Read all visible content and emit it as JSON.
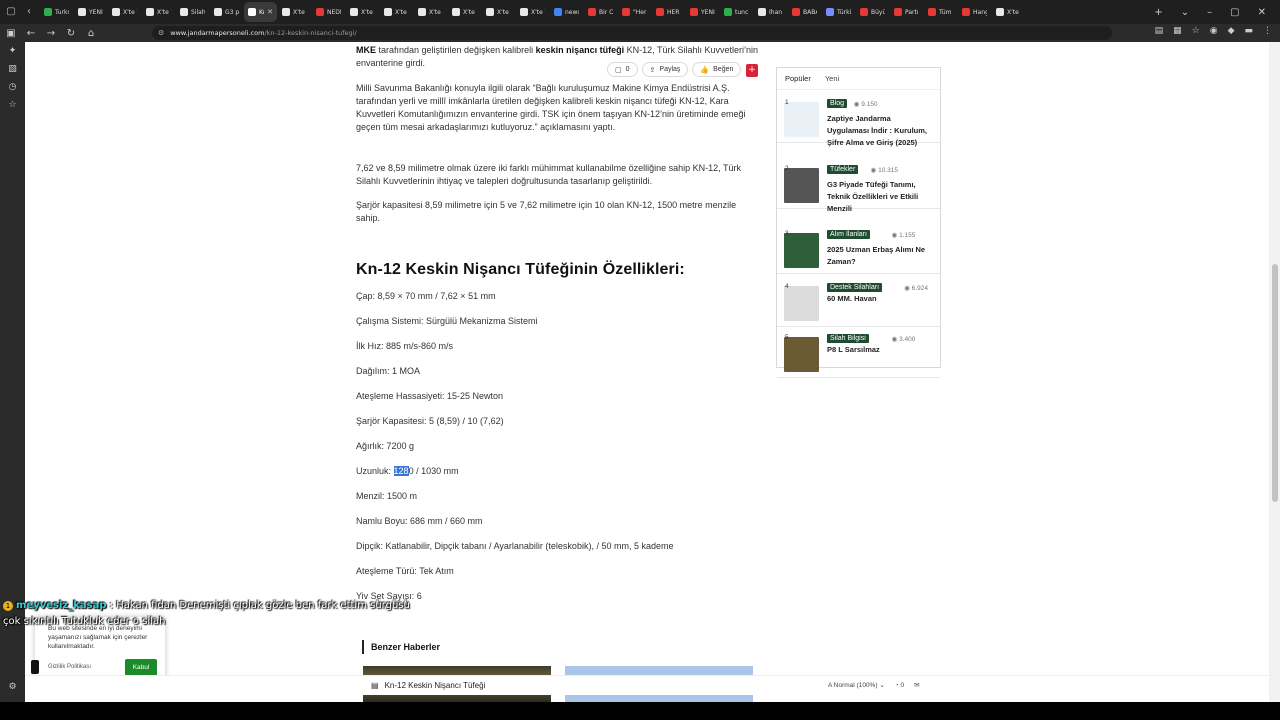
{
  "browser": {
    "tabs": [
      {
        "title": "Turkso",
        "color": "#2eae4f"
      },
      {
        "title": "YENİ I",
        "color": "#e8e8e8"
      },
      {
        "title": "X'te Tı",
        "color": "#e8e8e8"
      },
      {
        "title": "X'te Tı",
        "color": "#e8e8e8"
      },
      {
        "title": "Silah",
        "color": "#e8e8e8"
      },
      {
        "title": "G3 pi",
        "color": "#e8e8e8"
      },
      {
        "title": "Kn",
        "color": "#ffffff",
        "active": true
      },
      {
        "title": "X'te H",
        "color": "#e8e8e8"
      },
      {
        "title": "NEDİ",
        "color": "#e53935"
      },
      {
        "title": "X'te D",
        "color": "#e8e8e8"
      },
      {
        "title": "X'te E",
        "color": "#e8e8e8"
      },
      {
        "title": "X'te A",
        "color": "#e8e8e8"
      },
      {
        "title": "X'te E",
        "color": "#e8e8e8"
      },
      {
        "title": "X'te M",
        "color": "#e8e8e8"
      },
      {
        "title": "X'te T",
        "color": "#e8e8e8"
      },
      {
        "title": "news",
        "color": "#4285f4"
      },
      {
        "title": "Bir C",
        "color": "#e53935"
      },
      {
        "title": "\"Her i",
        "color": "#e53935"
      },
      {
        "title": "HER İ",
        "color": "#e53935"
      },
      {
        "title": "YENİ",
        "color": "#e53935"
      },
      {
        "title": "tunc",
        "color": "#2eae4f"
      },
      {
        "title": "İhan",
        "color": "#e8e8e8"
      },
      {
        "title": "BABA",
        "color": "#e53935"
      },
      {
        "title": "Türki",
        "color": "#7a8cff"
      },
      {
        "title": "Büyü",
        "color": "#e53935"
      },
      {
        "title": "Partı",
        "color": "#e53935"
      },
      {
        "title": "Tüm",
        "color": "#e53935"
      },
      {
        "title": "Hang",
        "color": "#e53935"
      },
      {
        "title": "X'te",
        "color": "#e8e8e8"
      }
    ],
    "url_domain": "www.jandarmapersoneli.com",
    "url_path": "/kn-12-keskin-nisanci-tufegi/"
  },
  "article": {
    "para1_bold": "MKE",
    "para1_mid": " tarafından geliştirilen değişken kalibreli ",
    "para1_bold2": "keskin nişancı tüfeği",
    "para1_end": " KN-12, Türk Silahlı Kuvvetleri’nin envanterine girdi.",
    "para2": "Milli Savunma Bakanlığı konuyla ilgili olarak “Bağlı kuruluşumuz Makine Kimya Endüstrisi A.Ş. tarafından yerli ve millî imkânlarla üretilen değişken kalibreli keskin nişancı tüfeği KN-12, Kara Kuvvetleri Komutanlığımızın envanterine girdi. TSK için önem taşıyan KN-12’nin üretiminde emeği geçen tüm mesai arkadaşlarımızı kutluyoruz.” açıklamasını yaptı.",
    "para3": "7,62 ve 8,59 milimetre olmak üzere iki farklı mühimmat kullanabilme özelliğine sahip KN-12, Türk Silahlı Kuvvetlerinin ihtiyaç ve talepleri doğrultusunda tasarlanıp geliştirildi.",
    "para4": "Şarjör kapasitesi 8,59 milimetre için 5 ve 7,62 milimetre için 10 olan KN-12, 1500 metre menzile sahip.",
    "heading": "Kn-12 Keskin Nişancı Tüfeğinin Özellikleri:",
    "specs": [
      "Çap: 8,59 × 70 mm / 7,62 × 51 mm",
      "Çalışma Sistemi: Sürgülü Mekanizma Sistemi",
      "İlk Hız: 885 m/s-860 m/s",
      "Dağılım: 1 MOA",
      "Ateşleme Hassasiyeti: 15-25 Newton",
      "Şarjör Kapasitesi: 5 (8,59) / 10 (7,62)",
      "Ağırlık: 7200 g"
    ],
    "length_prefix": "Uzunluk: ",
    "length_selected": "128",
    "length_rest": "0 / 1030 mm",
    "specs2": [
      "Menzil: 1500 m",
      "Namlu Boyu: 686 mm / 660 mm",
      "Dipçik: Katlanabilir, Dipçik tabanı / Ayarlanabilir (teleskobik), / 50 mm, 5 kademe",
      "Ateşleme Türü: Tek Atım",
      "Yiv Set Sayısı: 6"
    ],
    "actions": {
      "comments": "0",
      "share": "Paylaş",
      "like": "Beğen"
    },
    "related_title": "Benzer Haberler"
  },
  "widget": {
    "tab_popular": "Popüler",
    "tab_new": "Yeni",
    "items": [
      {
        "num": "1",
        "cat": "Blog",
        "views": "9.150",
        "title": "Zaptiye Jandarma Uygulaması İndir : Kurulum, Şifre Alma ve Giriş (2025)",
        "thumb": "#e9f1f7"
      },
      {
        "num": "2",
        "cat": "Tüfekler",
        "views": "10.315",
        "title": "G3 Piyade Tüfeği Tanımı, Teknik Özellikleri ve Etkili Menzili",
        "thumb": "#555555"
      },
      {
        "num": "3",
        "cat": "Alım İlanları",
        "views": "1.155",
        "title": "2025 Uzman Erbaş Alımı Ne Zaman?",
        "thumb": "#2f5f3a"
      },
      {
        "num": "4",
        "cat": "Destek Silahları",
        "views": "6.924",
        "title": "60 MM. Havan",
        "thumb": "#dcdcdc"
      },
      {
        "num": "5",
        "cat": "Silah Bilgisi",
        "views": "3.400",
        "title": "P8 L Sarsılmaz",
        "thumb": "#6b5a34"
      }
    ]
  },
  "cookie": {
    "text": "Bu web sitesinde en iyi deneyimi yaşamanızı sağlamak için çerezler kullanılmaktadır.",
    "policy": "Gizlilik Politikası",
    "accept": "Kabul"
  },
  "chat": {
    "badge": "1",
    "user": "meyvesiz_kasap",
    "msg1": " : Hakan fidan Denemişti çıplak gözle ben fark ettim sürgüsü",
    "msg2": "çok sıkıntılı Tutukluk eder o silah"
  },
  "bottom": {
    "title": "Kn-12 Keskin Nişancı Tüfeği",
    "font_size": "Normal (100%)",
    "comments": "0"
  },
  "colors": {
    "accent": "#d6233a",
    "category": "#1f4b31",
    "accept": "#1b8a2a",
    "selection": "#3a76d8"
  }
}
